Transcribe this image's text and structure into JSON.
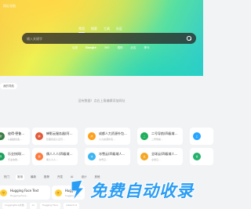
{
  "header": {
    "logo_text": "网址导航"
  },
  "search": {
    "tabs": [
      "常用",
      "搜索",
      "工具",
      "社区"
    ],
    "active_tab": 0,
    "placeholder": "输入关键字",
    "engines": [
      "百度",
      "Google",
      "360",
      "搜狗",
      "必应",
      "神马"
    ],
    "active_engine": 1
  },
  "chip_label": "我的导航",
  "notice": "没有数据！点右上角编辑添加网址",
  "cards": [
    {
      "title": "彼得·德鲁克的AI...",
      "desc": "从超越创造...",
      "color": "#3a7d44",
      "glyph": "智"
    },
    {
      "title": "蝉影云服务器(阿里...",
      "desc": "仅需实名认证可...",
      "color": "#e25c3a",
      "glyph": "蝉"
    },
    {
      "title": "成都人力资源外包...",
      "desc": "人力资源外包...",
      "color": "#ff9f1a",
      "glyph": "成"
    },
    {
      "title": "二号导航(四级域名...",
      "desc": "二号导航...",
      "color": "#1fae5a",
      "glyph": "二"
    },
    {
      "title": "上官网(阿里巴巴...",
      "desc": "上官网是...",
      "color": "#26a4ff",
      "glyph": "上"
    },
    {
      "title": "乐业快网(四级域人...",
      "desc": "乐业快网...",
      "color": "#1aa05a",
      "glyph": "乐"
    },
    {
      "title": "偶人人人(四级域人...",
      "desc": "偶人人人...",
      "color": "#ff7a3d",
      "glyph": "偶"
    },
    {
      "title": "冰雪云(四级域人...",
      "desc": "冰雪云...",
      "color": "#3ab4f2",
      "glyph": "冰"
    },
    {
      "title": "全球云(四级域人...",
      "desc": "全球云...",
      "color": "#f5a623",
      "glyph": "全"
    },
    {
      "title": "优选免费(四级域人...",
      "desc": "优选免费...",
      "color": "#23b26b",
      "glyph": "优"
    }
  ],
  "section_tabs": [
    "热门",
    "常用",
    "最新",
    "推荐",
    "开发",
    "AI",
    "设计",
    "其他"
  ],
  "active_section_tab": 1,
  "bottom_cards": [
    {
      "title": "Hugging Face Text",
      "desc": "Hugging Face..."
    },
    {
      "title": "Hugging",
      "desc": "huggingface..."
    }
  ],
  "bottom_bar": [
    "huggingface文档",
    "AI",
    "Hugging Face",
    "instant-id"
  ],
  "watermark": {
    "text": "免费自动收录"
  },
  "colors": {
    "search_bg": "#282828",
    "watermark": "#2a9df4"
  }
}
